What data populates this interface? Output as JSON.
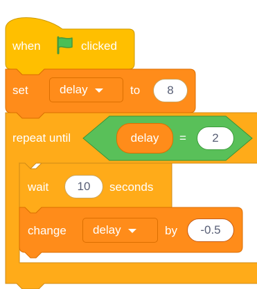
{
  "script": {
    "hat": {
      "word_when": "when",
      "icon": "green-flag-icon",
      "word_clicked": "clicked"
    },
    "set_block": {
      "word_set": "set",
      "variable": "delay",
      "word_to": "to",
      "value": "8"
    },
    "repeat_block": {
      "word_repeat_until": "repeat until",
      "condition": {
        "left_reporter": "delay",
        "operator": "=",
        "right_value": "2"
      }
    },
    "wait_block": {
      "word_wait": "wait",
      "value": "10",
      "word_seconds": "seconds"
    },
    "change_block": {
      "word_change": "change",
      "variable": "delay",
      "word_by": "by",
      "value": "-0.5"
    }
  },
  "colors": {
    "events_fill": "#ffbf00",
    "events_stroke": "#cc9900",
    "variables_fill": "#ff8c1a",
    "variables_stroke": "#db6e00",
    "control_fill": "#ffab19",
    "control_stroke": "#cf8b17",
    "operators_fill": "#59c059",
    "operators_stroke": "#389438",
    "flag_green": "#4cbf56"
  }
}
